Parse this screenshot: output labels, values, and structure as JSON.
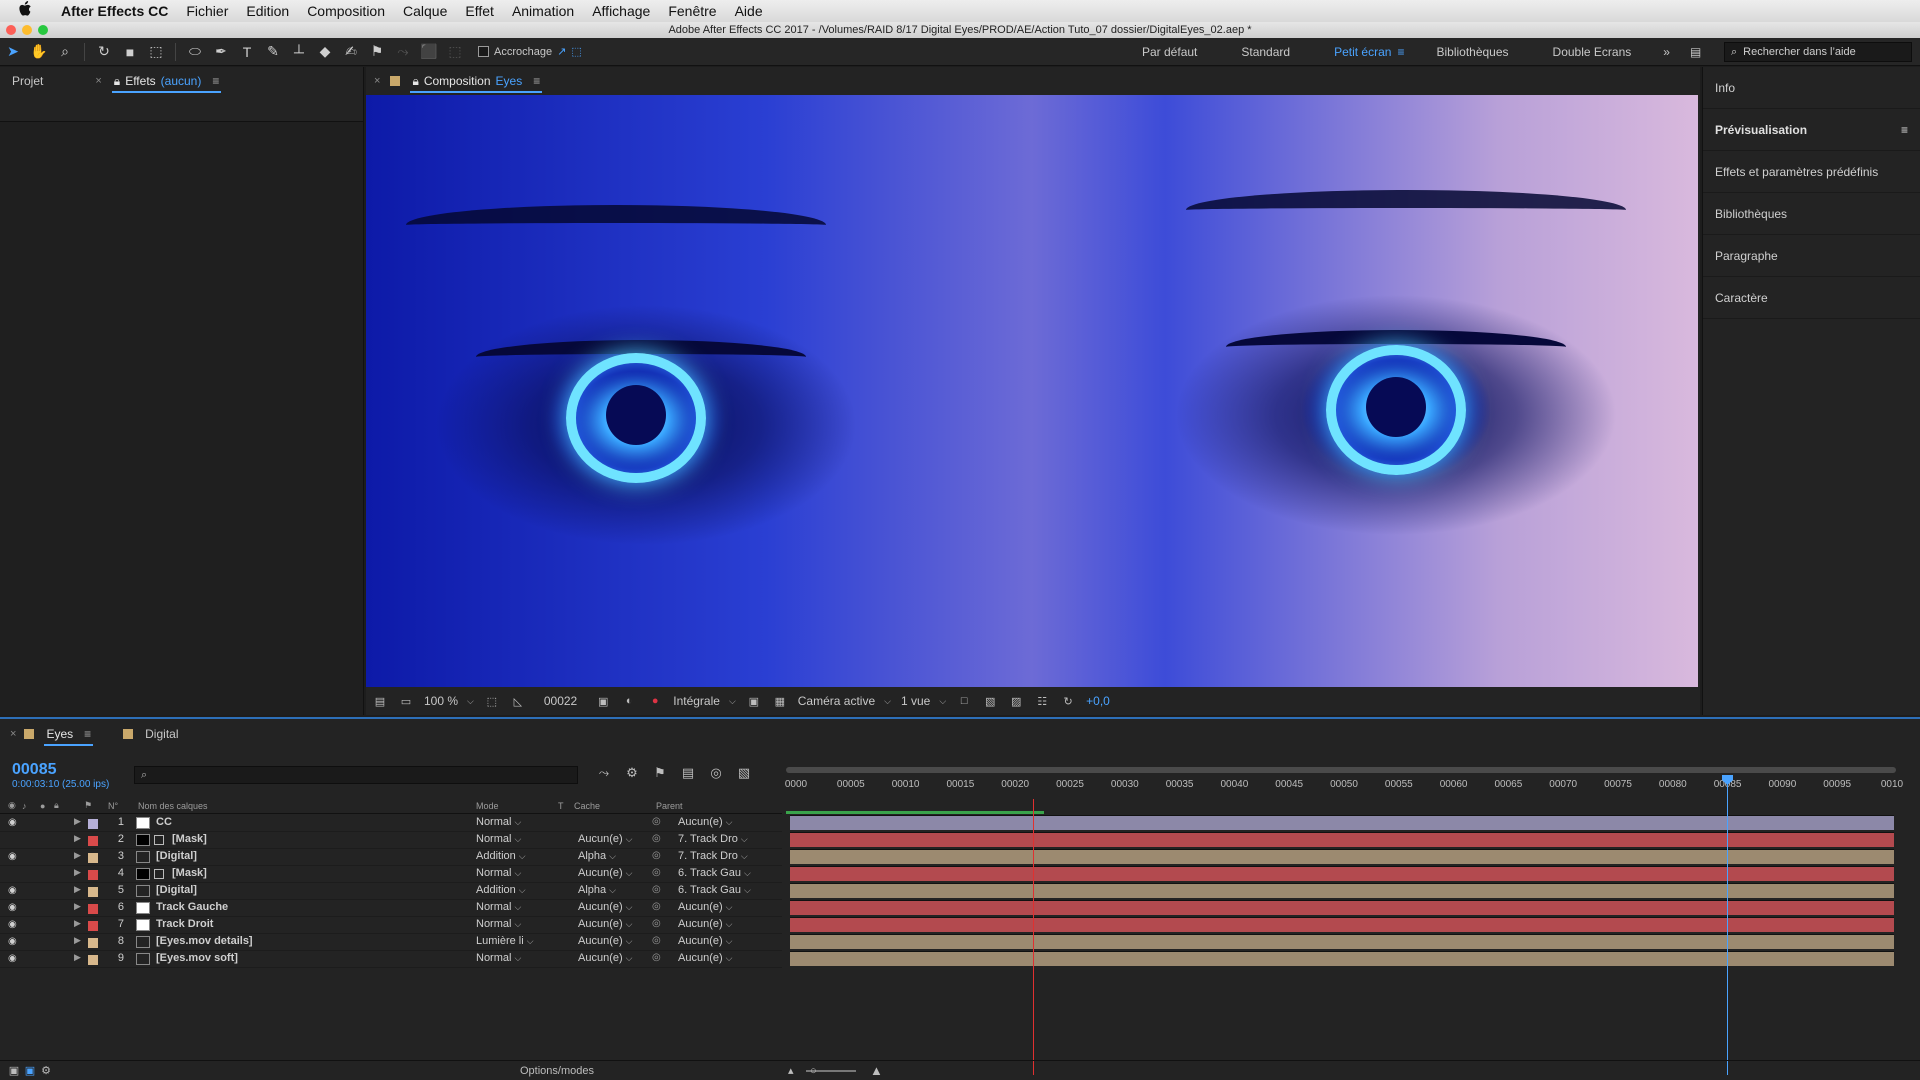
{
  "menubar": {
    "apple": "",
    "items": [
      "After Effects CC",
      "Fichier",
      "Edition",
      "Composition",
      "Calque",
      "Effet",
      "Animation",
      "Affichage",
      "Fenêtre",
      "Aide"
    ]
  },
  "window": {
    "title": "Adobe After Effects CC 2017 - /Volumes/RAID 8/17 Digital Eyes/PROD/AE/Action Tuto_07 dossier/DigitalEyes_02.aep *"
  },
  "toolbar": {
    "snap_label": "Accrochage",
    "workspaces": [
      "Par défaut",
      "Standard",
      "Petit écran",
      "Bibliothèques",
      "Double Ecrans"
    ],
    "active_workspace": "Petit écran",
    "search_placeholder": "Rechercher dans l’aide"
  },
  "left_panel": {
    "tab_project": "Projet",
    "tab_effects": "Effets",
    "tab_effects_value": "(aucun)"
  },
  "composition": {
    "tab_label": "Composition",
    "comp_name": "Eyes",
    "footer": {
      "zoom": "100 %",
      "frame": "00022",
      "resolution": "Intégrale",
      "camera": "Caméra active",
      "view": "1 vue",
      "exposure": "+0,0"
    }
  },
  "right_panel": {
    "items": [
      "Info",
      "Prévisualisation",
      "Effets et paramètres prédéfinis",
      "Bibliothèques",
      "Paragraphe",
      "Caractère"
    ]
  },
  "timeline": {
    "tab_active": "Eyes",
    "tab_other": "Digital",
    "current_frame": "00085",
    "timecode": "0:00:03:10 (25.00 ips)",
    "columns": {
      "number": "N°",
      "name": "Nom des calques",
      "mode": "Mode",
      "t": "T",
      "cache": "Cache",
      "parent": "Parent"
    },
    "layers": [
      {
        "num": "1",
        "name": "CC",
        "mode": "Normal",
        "cache": "",
        "parent": "Aucun(e)",
        "label_color": "#b6b0d8",
        "icon": "solid",
        "visible": true
      },
      {
        "num": "2",
        "name": "[Mask]",
        "mode": "Normal",
        "cache": "Aucun(e)",
        "parent": "7. Track Dro",
        "label_color": "#d94a4a",
        "icon": "mask",
        "visible": false
      },
      {
        "num": "3",
        "name": "[Digital]",
        "mode": "Addition",
        "cache": "Alpha",
        "parent": "7. Track Dro",
        "label_color": "#d8b88c",
        "icon": "comp",
        "visible": true
      },
      {
        "num": "4",
        "name": "[Mask]",
        "mode": "Normal",
        "cache": "Aucun(e)",
        "parent": "6. Track Gau",
        "label_color": "#d94a4a",
        "icon": "mask",
        "visible": false
      },
      {
        "num": "5",
        "name": "[Digital]",
        "mode": "Addition",
        "cache": "Alpha",
        "parent": "6. Track Gau",
        "label_color": "#d8b88c",
        "icon": "comp",
        "visible": true
      },
      {
        "num": "6",
        "name": "Track Gauche",
        "mode": "Normal",
        "cache": "Aucun(e)",
        "parent": "Aucun(e)",
        "label_color": "#d94a4a",
        "icon": "solid",
        "visible": true
      },
      {
        "num": "7",
        "name": "Track Droit",
        "mode": "Normal",
        "cache": "Aucun(e)",
        "parent": "Aucun(e)",
        "label_color": "#d94a4a",
        "icon": "solid",
        "visible": true
      },
      {
        "num": "8",
        "name": "[Eyes.mov details]",
        "mode": "Lumière li",
        "cache": "Aucun(e)",
        "parent": "Aucun(e)",
        "label_color": "#d8b88c",
        "icon": "comp",
        "visible": true
      },
      {
        "num": "9",
        "name": "[Eyes.mov soft]",
        "mode": "Normal",
        "cache": "Aucun(e)",
        "parent": "Aucun(e)",
        "label_color": "#d8b88c",
        "icon": "comp",
        "visible": true
      }
    ],
    "ruler_ticks": [
      "0000",
      "00005",
      "00010",
      "00015",
      "00020",
      "00025",
      "00030",
      "00035",
      "00040",
      "00045",
      "00050",
      "00055",
      "00060",
      "00065",
      "00070",
      "00075",
      "00080",
      "00085",
      "00090",
      "00095",
      "0010"
    ],
    "track_colors": {
      "red": "#b34a4f",
      "tan": "#9c8a70",
      "lilac": "#8c88a8"
    },
    "options_label": "Options/modes"
  }
}
